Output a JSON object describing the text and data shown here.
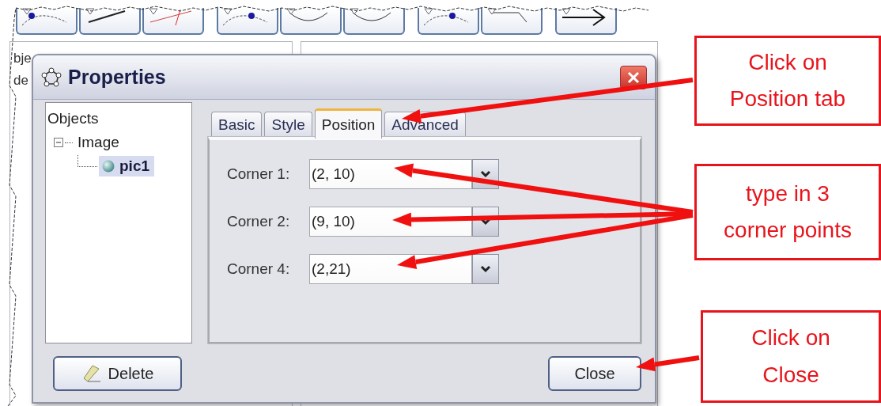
{
  "background": {
    "side_texts": [
      "bje",
      "de"
    ]
  },
  "dialog": {
    "title": "Properties",
    "tree": {
      "label": "Objects",
      "children": [
        {
          "label": "Image",
          "expanded": true,
          "selected": false,
          "children": [
            {
              "label": "pic1",
              "selected": true
            }
          ]
        }
      ]
    },
    "tabs": [
      {
        "label": "Basic",
        "selected": false
      },
      {
        "label": "Style",
        "selected": false
      },
      {
        "label": "Position",
        "selected": true
      },
      {
        "label": "Advanced",
        "selected": false
      }
    ],
    "fields": [
      {
        "label": "Corner 1:",
        "value": "(2, 10)"
      },
      {
        "label": "Corner 2:",
        "value": "(9, 10)"
      },
      {
        "label": "Corner 4:",
        "value": "(2,21)"
      }
    ],
    "delete_button": "Delete",
    "close_button": "Close"
  },
  "callouts": [
    {
      "lines": [
        "Click on",
        "Position tab"
      ]
    },
    {
      "lines": [
        "type in 3",
        "corner points"
      ]
    },
    {
      "lines": [
        "Click on",
        "Close"
      ]
    }
  ]
}
